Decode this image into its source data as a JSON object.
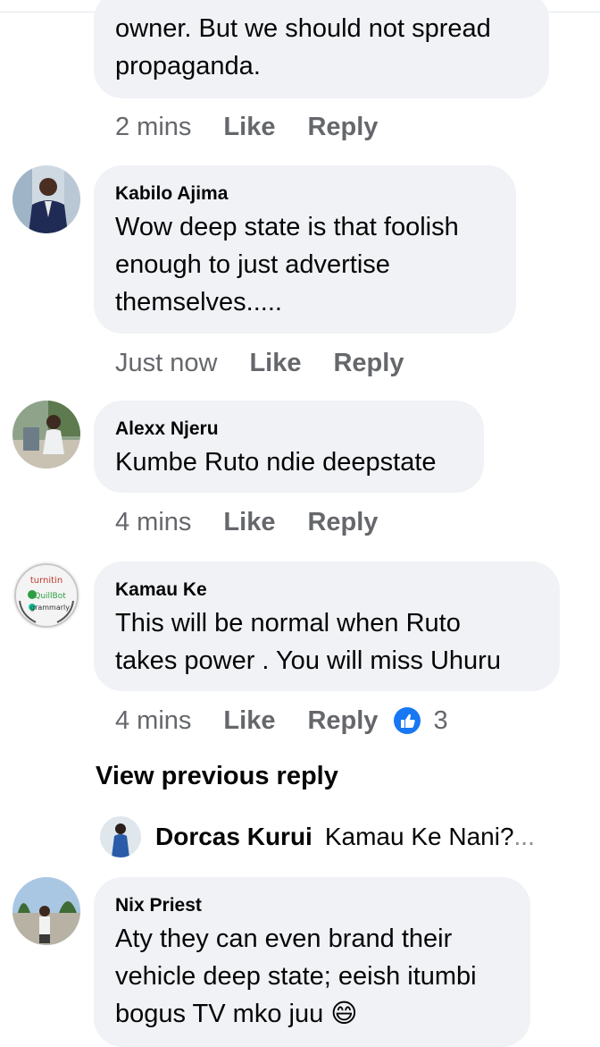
{
  "comments": [
    {
      "text_lines": [
        "owner. But we should not spread",
        "propaganda."
      ],
      "time": "2 mins",
      "like": "Like",
      "reply": "Reply"
    },
    {
      "author": "Kabilo Ajima",
      "text_lines": [
        "Wow deep state is that foolish",
        "enough to just advertise",
        "themselves....."
      ],
      "time": "Just now",
      "like": "Like",
      "reply": "Reply"
    },
    {
      "author": "Alexx Njeru",
      "text_lines": [
        "Kumbe Ruto ndie deepstate"
      ],
      "time": "4 mins",
      "like": "Like",
      "reply": "Reply"
    },
    {
      "author": "Kamau Ke",
      "text_lines": [
        "This will be normal when Ruto",
        "takes power . You will miss Uhuru"
      ],
      "time": "4 mins",
      "like": "Like",
      "reply": "Reply",
      "reaction_count": "3",
      "reaction_icon": "thumbs-up-icon",
      "reaction_color": "#1877f2"
    },
    {
      "author": "Nix Priest",
      "text_lines": [
        "Aty they can even brand their",
        "vehicle deep state; eeish itumbi",
        "bogus TV mko juu"
      ],
      "emoji": "😄"
    }
  ],
  "view_previous_reply": "View previous reply",
  "nested_reply": {
    "author": "Dorcas Kurui",
    "text": "Kamau Ke Nani?",
    "ellipsis": "..."
  },
  "avatar_logo_words": [
    "turnitin",
    "QuillBot",
    "grammarly"
  ]
}
